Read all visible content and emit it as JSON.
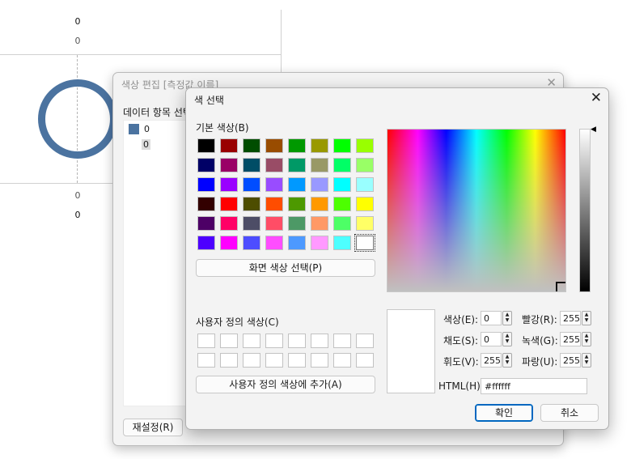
{
  "background_chart": {
    "labels_top": [
      "0",
      "0"
    ],
    "labels_bottom": [
      "0",
      "0"
    ],
    "ring_color": "#4b73a0"
  },
  "back_dialog": {
    "title": "색상 편집 [측정값 이름]",
    "section_label": "데이터 항목 선택",
    "list_items": [
      "0",
      "0"
    ],
    "reset_button": "재설정(R)"
  },
  "color_dialog": {
    "title": "색 선택",
    "basic_colors_label": "기본 색상(B)",
    "basic_colors": [
      "#000000",
      "#990000",
      "#004d00",
      "#994c00",
      "#009900",
      "#999900",
      "#00ff00",
      "#99ff00",
      "#000066",
      "#990066",
      "#004d66",
      "#994c66",
      "#009966",
      "#999966",
      "#00ff66",
      "#99ff66",
      "#0000ff",
      "#9900ff",
      "#004dff",
      "#994cff",
      "#0099ff",
      "#9999ff",
      "#00ffff",
      "#99ffff",
      "#330000",
      "#ff0000",
      "#4d4d00",
      "#ff4d00",
      "#4d9900",
      "#ff9900",
      "#4dff00",
      "#ffff00",
      "#4d0066",
      "#ff0066",
      "#4d4d66",
      "#ff4d66",
      "#4d9966",
      "#ff9966",
      "#4dff66",
      "#ffff66",
      "#4d00ff",
      "#ff00ff",
      "#4d4dff",
      "#ff4dff",
      "#4d99ff",
      "#ff99ff",
      "#4dffff",
      "#ffffff"
    ],
    "pick_screen_button": "화면 색상 선택(P)",
    "custom_colors_label": "사용자 정의 색상(C)",
    "add_custom_button": "사용자 정의 색상에 추가(A)",
    "fields": {
      "hue": {
        "label": "색상(E):",
        "value": "0"
      },
      "sat": {
        "label": "채도(S):",
        "value": "0"
      },
      "val": {
        "label": "휘도(V):",
        "value": "255"
      },
      "red": {
        "label": "빨강(R):",
        "value": "255"
      },
      "green": {
        "label": "녹색(G):",
        "value": "255"
      },
      "blue": {
        "label": "파랑(U):",
        "value": "255"
      }
    },
    "html_label": "HTML(H):",
    "html_value": "#ffffff",
    "ok_button": "확인",
    "cancel_button": "취소",
    "close_icon": "close-icon",
    "accent_color": "#0067c0"
  }
}
